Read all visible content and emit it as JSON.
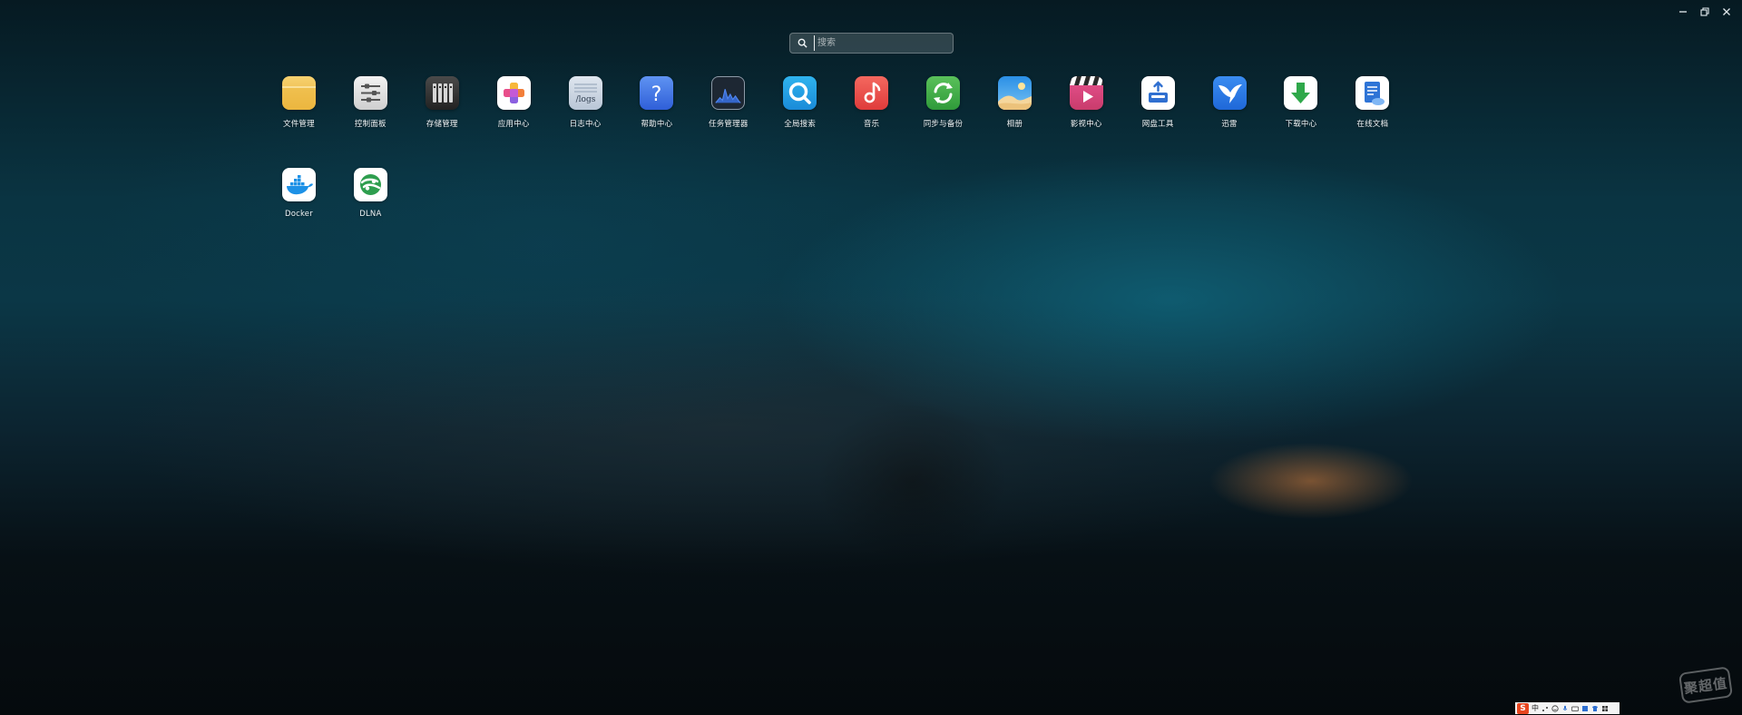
{
  "window_controls": {
    "minimize": "minimize-icon",
    "restore": "restore-icon",
    "close": "close-icon"
  },
  "search": {
    "placeholder": "搜索",
    "value": ""
  },
  "apps": [
    {
      "label": "文件管理",
      "icon": "folder-icon"
    },
    {
      "label": "控制面板",
      "icon": "control-panel-icon"
    },
    {
      "label": "存储管理",
      "icon": "storage-icon"
    },
    {
      "label": "应用中心",
      "icon": "app-center-icon"
    },
    {
      "label": "日志中心",
      "icon": "logs-icon",
      "icon_text": "/logs"
    },
    {
      "label": "帮助中心",
      "icon": "help-icon",
      "icon_text": "?"
    },
    {
      "label": "任务管理器",
      "icon": "task-manager-icon"
    },
    {
      "label": "全局搜索",
      "icon": "global-search-icon"
    },
    {
      "label": "音乐",
      "icon": "music-icon"
    },
    {
      "label": "同步与备份",
      "icon": "sync-backup-icon"
    },
    {
      "label": "相册",
      "icon": "photos-icon"
    },
    {
      "label": "影视中心",
      "icon": "video-center-icon"
    },
    {
      "label": "网盘工具",
      "icon": "cloud-drive-icon"
    },
    {
      "label": "迅雷",
      "icon": "xunlei-icon"
    },
    {
      "label": "下载中心",
      "icon": "download-icon"
    },
    {
      "label": "在线文档",
      "icon": "online-docs-icon"
    },
    {
      "label": "Docker",
      "icon": "docker-icon"
    },
    {
      "label": "DLNA",
      "icon": "dlna-icon"
    }
  ],
  "tray": {
    "logo": "S",
    "lang": "中",
    "icons": [
      "punctuation-icon",
      "emoji-icon",
      "mic-icon",
      "keyboard-icon",
      "skin-icon",
      "shirt-icon",
      "toolbox-icon"
    ]
  },
  "watermark": "聚超值",
  "colors": {
    "accent": "#3b7de8",
    "label": "#f1f5f7"
  }
}
